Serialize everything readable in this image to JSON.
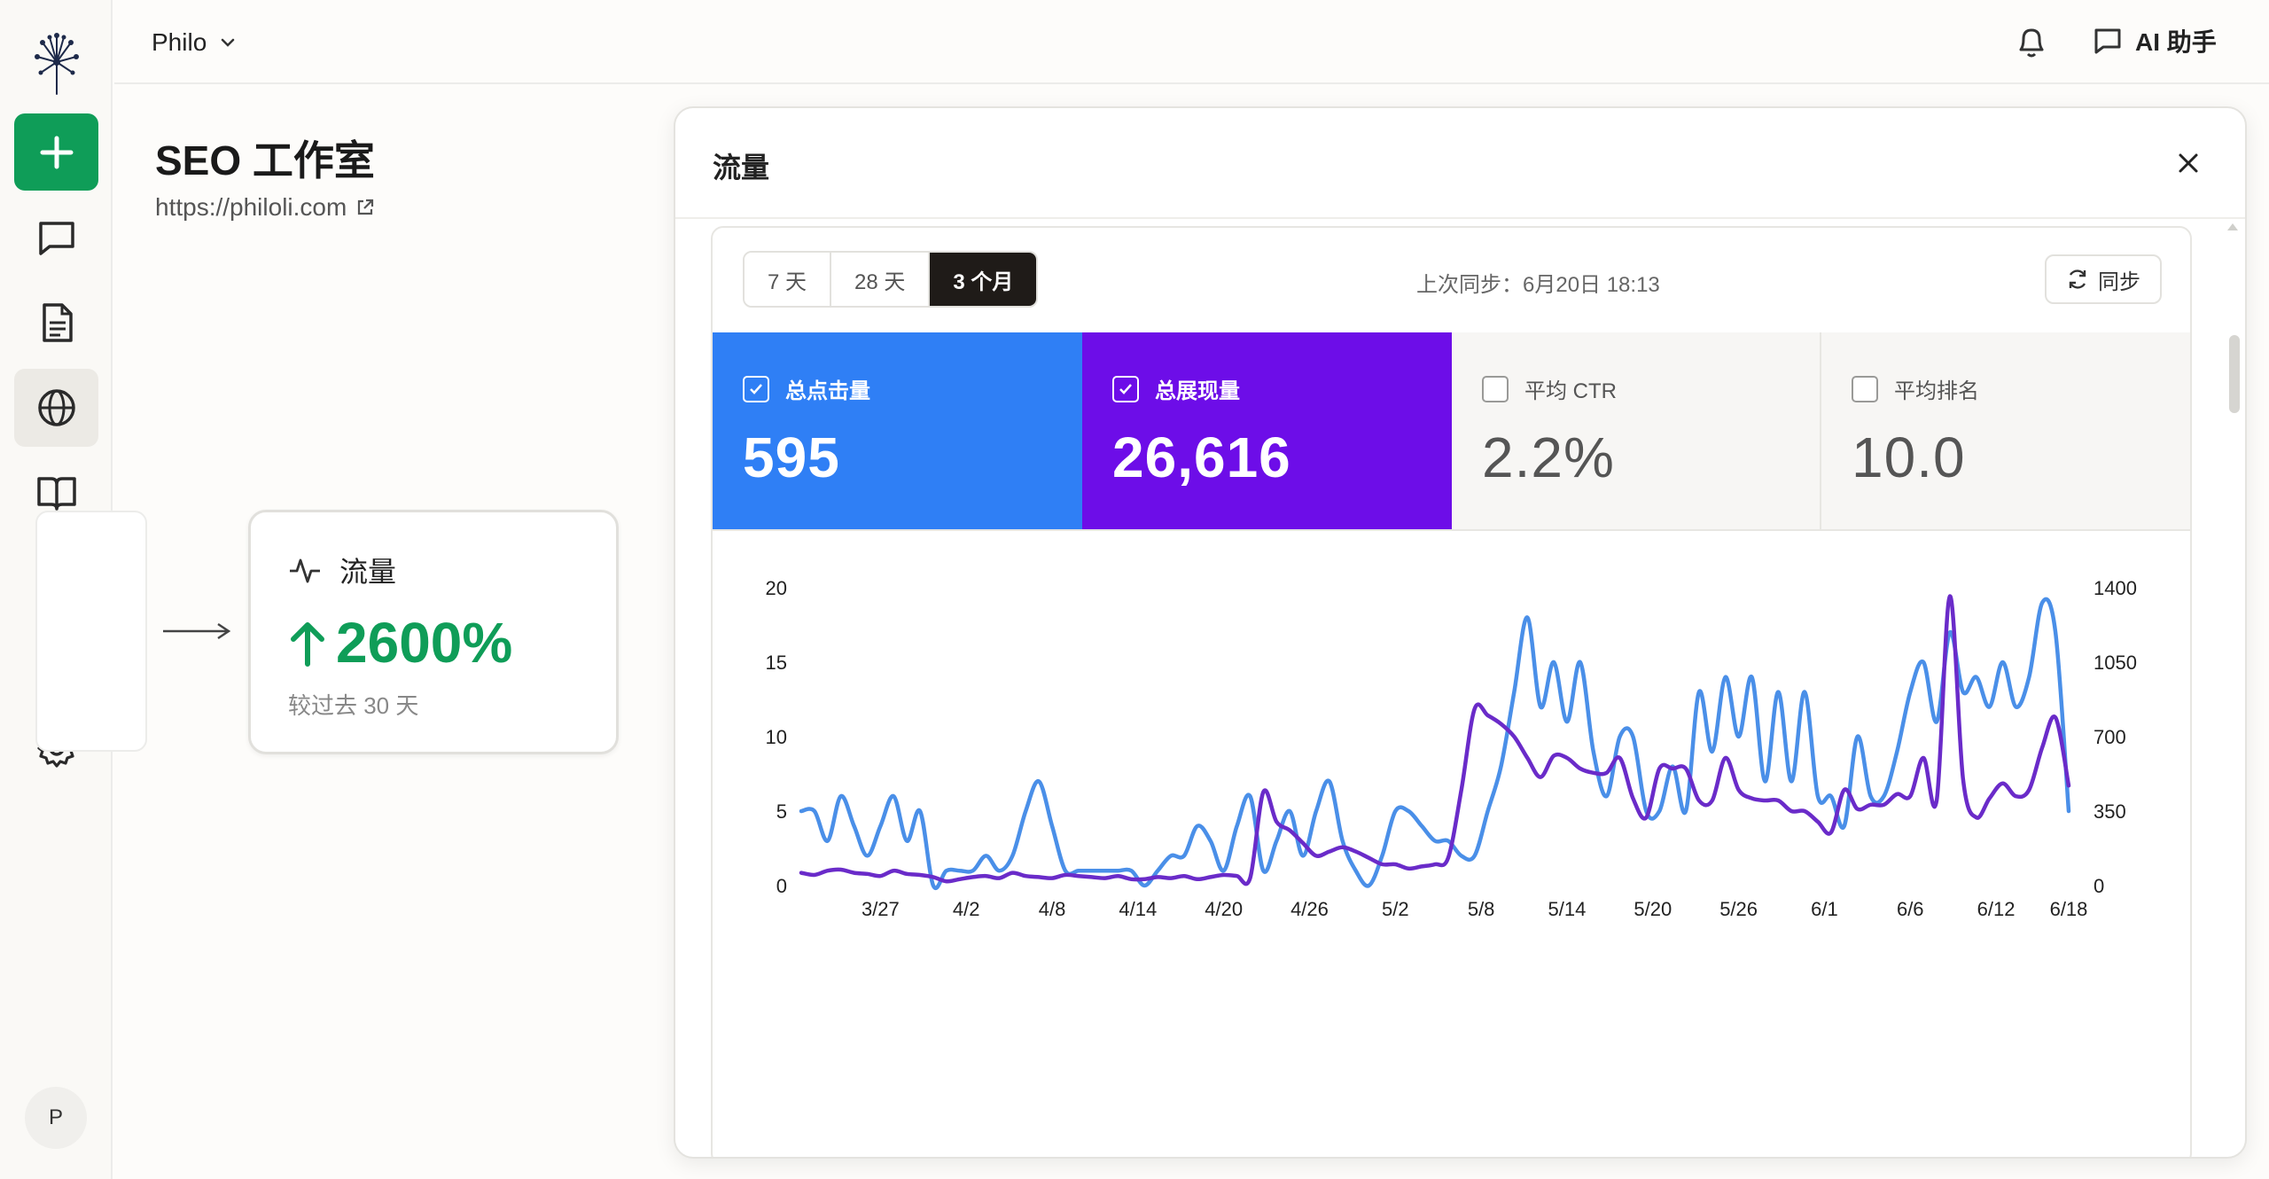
{
  "topbar": {
    "workspace": "Philo",
    "ai_label": "AI 助手"
  },
  "sidebar": {
    "avatar_initial": "P"
  },
  "site": {
    "title": "SEO 工作室",
    "url": "https://philoli.com"
  },
  "flow_card": {
    "title": "流量",
    "value": "2600%",
    "subtitle": "较过去 30 天"
  },
  "modal": {
    "title": "流量",
    "ranges": [
      "7 天",
      "28 天",
      "3 个月"
    ],
    "active_range": 2,
    "last_sync": "上次同步：6月20日 18:13",
    "sync_label": "同步",
    "metrics": [
      {
        "label": "总点击量",
        "value": "595",
        "checked": true,
        "color": "#2f7ff5"
      },
      {
        "label": "总展现量",
        "value": "26,616",
        "checked": true,
        "color": "#6d0de8"
      },
      {
        "label": "平均 CTR",
        "value": "2.2%",
        "checked": false
      },
      {
        "label": "平均排名",
        "value": "10.0",
        "checked": false
      }
    ]
  },
  "chart_data": {
    "type": "line",
    "categories": [
      "3/27",
      "4/2",
      "4/8",
      "4/14",
      "4/20",
      "4/26",
      "5/2",
      "5/8",
      "5/14",
      "5/20",
      "5/26",
      "6/1",
      "6/6",
      "6/12",
      "6/18"
    ],
    "left_axis": {
      "ticks": [
        0,
        5,
        10,
        15,
        20
      ],
      "range": [
        0,
        20
      ]
    },
    "right_axis": {
      "ticks": [
        0,
        350,
        700,
        1050,
        1400
      ],
      "range": [
        0,
        1400
      ]
    },
    "series": [
      {
        "name": "总点击量",
        "axis": "left",
        "color": "#4a8fe8",
        "values": [
          5,
          5,
          3,
          6,
          4,
          2,
          4,
          6,
          3,
          5,
          0,
          1,
          1,
          1,
          2,
          1,
          2,
          5,
          7,
          4,
          1,
          1,
          1,
          1,
          1,
          1,
          0,
          1,
          2,
          2,
          4,
          3,
          1,
          4,
          6,
          1,
          3,
          5,
          2,
          5,
          7,
          3,
          1,
          0,
          2,
          5,
          5,
          4,
          3,
          3,
          2,
          2,
          5,
          8,
          13,
          18,
          12,
          15,
          11,
          15,
          9,
          6,
          10,
          10,
          5,
          5,
          8,
          5,
          13,
          9,
          14,
          10,
          14,
          7,
          13,
          7,
          13,
          6,
          6,
          4,
          10,
          6,
          6,
          9,
          13,
          15,
          11,
          17,
          13,
          14,
          12,
          15,
          12,
          14,
          19,
          17,
          5
        ]
      },
      {
        "name": "总展现量",
        "axis": "right",
        "color": "#6a2bc9",
        "values": [
          60,
          50,
          70,
          75,
          60,
          55,
          45,
          70,
          55,
          50,
          40,
          20,
          30,
          40,
          45,
          35,
          60,
          45,
          40,
          35,
          50,
          45,
          40,
          35,
          45,
          30,
          30,
          40,
          35,
          45,
          30,
          40,
          50,
          45,
          35,
          440,
          300,
          260,
          200,
          140,
          160,
          180,
          160,
          130,
          100,
          100,
          80,
          90,
          100,
          130,
          450,
          830,
          800,
          760,
          700,
          600,
          510,
          610,
          600,
          550,
          530,
          530,
          600,
          410,
          320,
          550,
          550,
          550,
          400,
          400,
          600,
          450,
          410,
          400,
          400,
          350,
          350,
          300,
          250,
          450,
          360,
          380,
          380,
          430,
          420,
          600,
          400,
          1360,
          500,
          320,
          410,
          480,
          420,
          450,
          650,
          790,
          470
        ]
      }
    ]
  }
}
